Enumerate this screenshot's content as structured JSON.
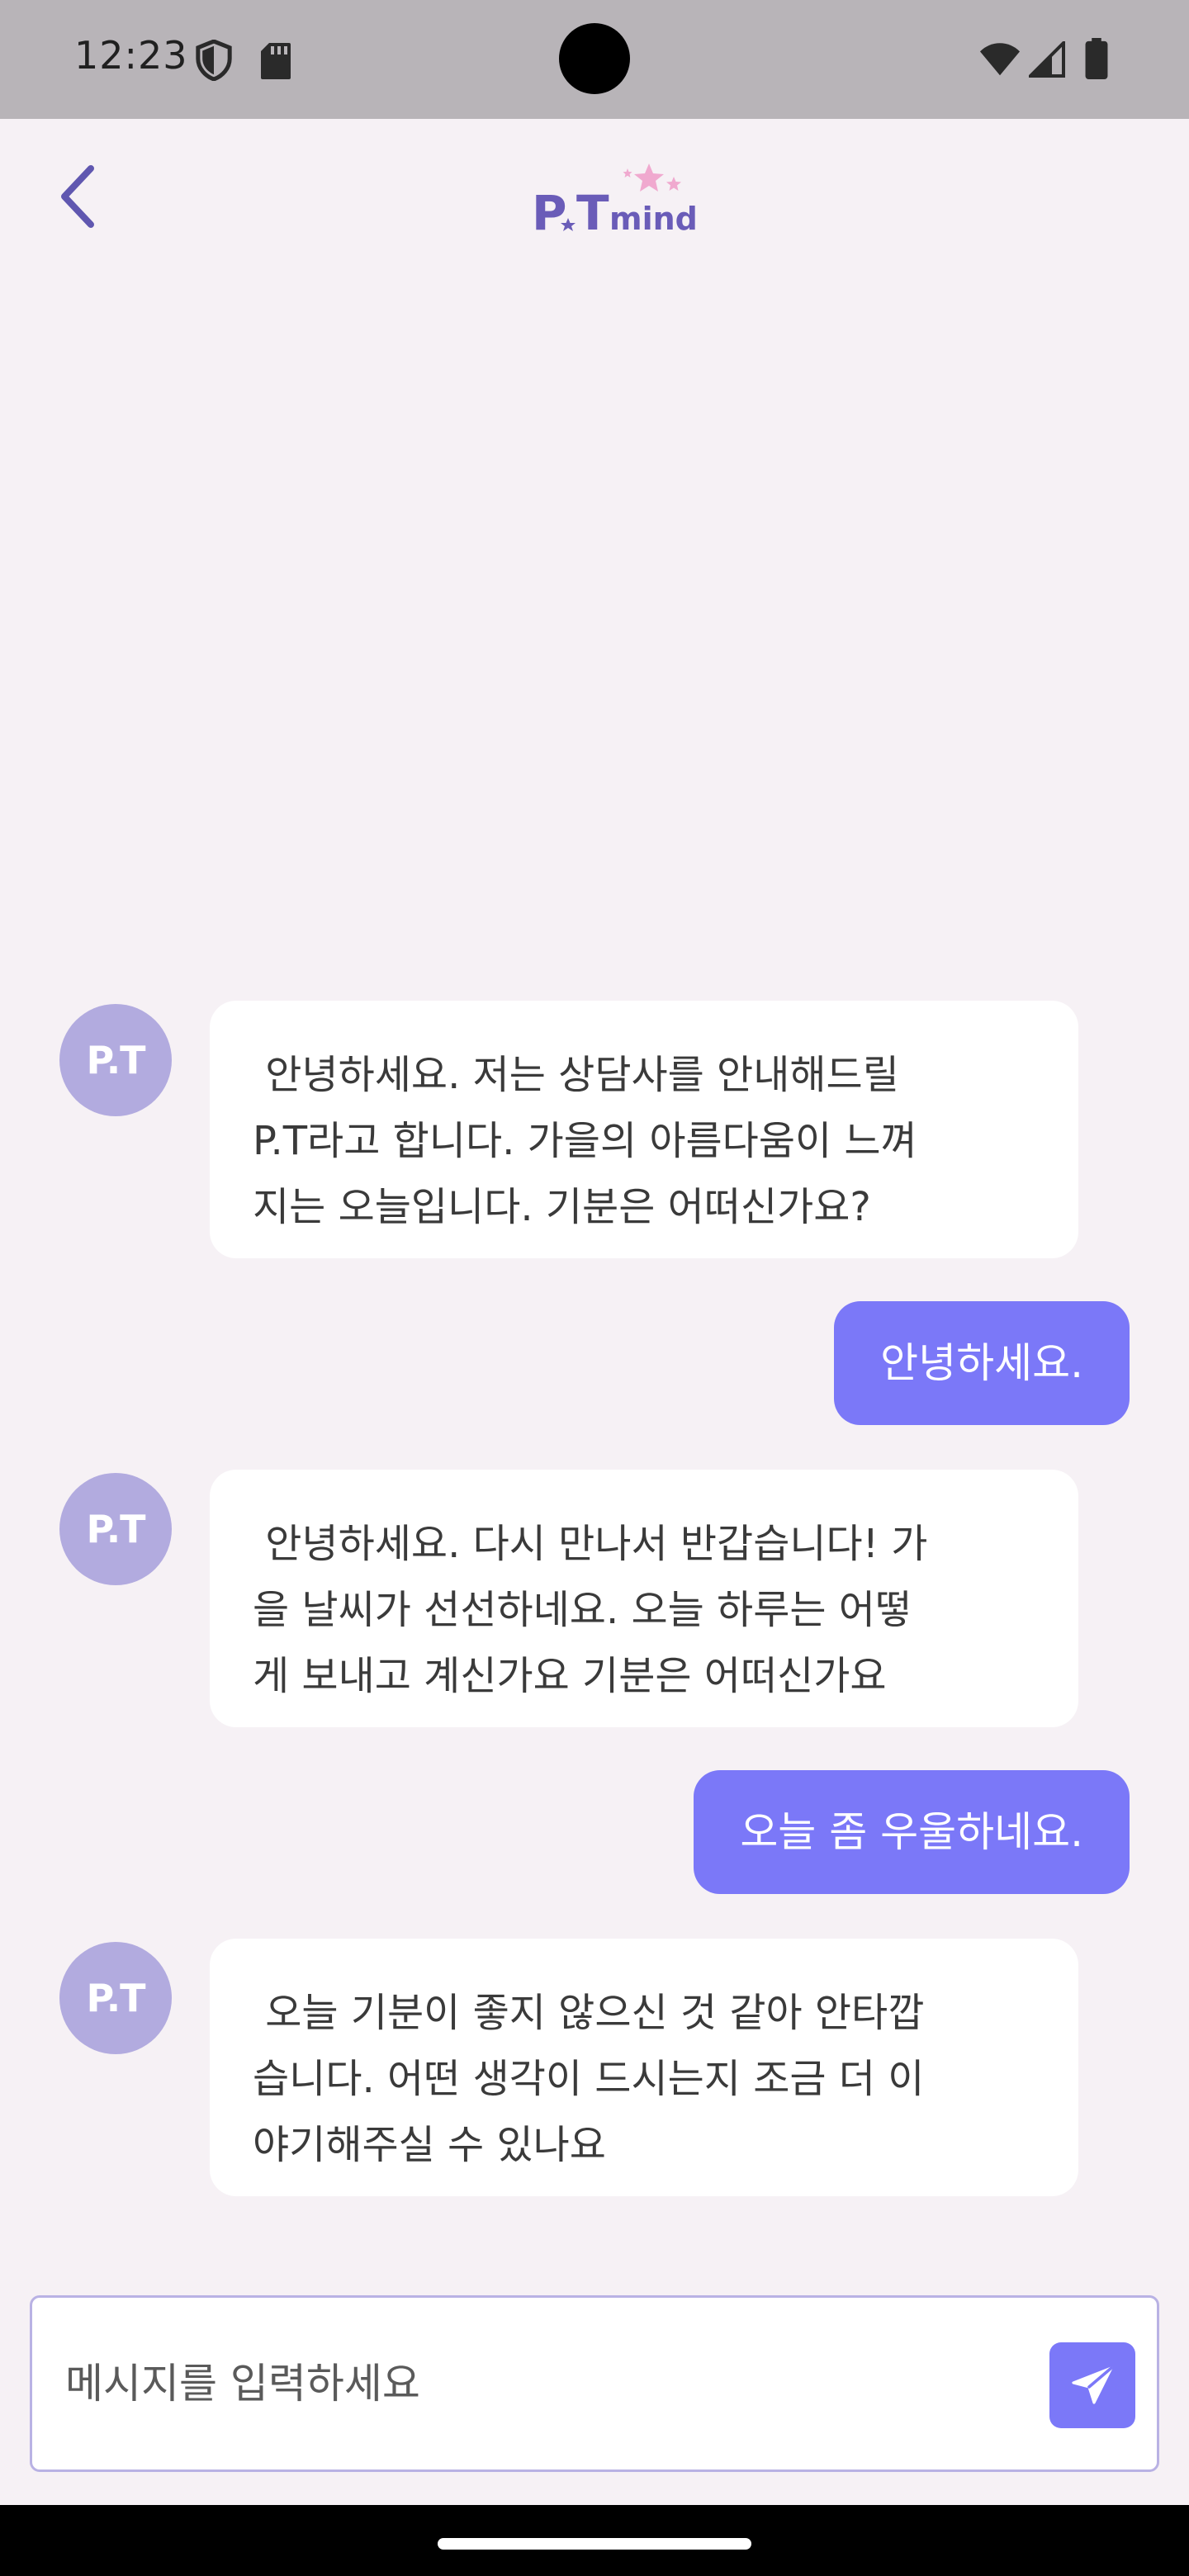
{
  "status_bar": {
    "time": "12:23",
    "icons": [
      "shield-icon",
      "sd-card-icon",
      "wifi-icon",
      "signal-icon",
      "battery-icon"
    ]
  },
  "header": {
    "back_icon": "chevron-left-icon",
    "logo": "P.T mind"
  },
  "colors": {
    "background": "#f6f1f5",
    "accent": "#7b78f8",
    "avatar": "#b2abdf",
    "bot_bubble": "#ffffff"
  },
  "messages": [
    {
      "sender": "bot",
      "avatar": "P.T",
      "text": " 안녕하세요. 저는 상담사를 안내해드릴\nP.T라고 합니다. 가을의 아름다움이 느껴\n지는 오늘입니다. 기분은 어떠신가요?"
    },
    {
      "sender": "user",
      "text": "안녕하세요."
    },
    {
      "sender": "bot",
      "avatar": "P.T",
      "text": " 안녕하세요. 다시 만나서 반갑습니다! 가\n을 날씨가 선선하네요. 오늘 하루는 어떻\n게 보내고 계신가요 기분은 어떠신가요"
    },
    {
      "sender": "user",
      "text": "오늘 좀 우울하네요."
    },
    {
      "sender": "bot",
      "avatar": "P.T",
      "text": " 오늘 기분이 좋지 않으신 것 같아 안타깝\n습니다. 어떤 생각이 드시는지 조금 더 이\n야기해주실 수 있나요"
    }
  ],
  "input": {
    "value": "",
    "placeholder": "메시지를 입력하세요",
    "send_icon": "send-icon"
  }
}
